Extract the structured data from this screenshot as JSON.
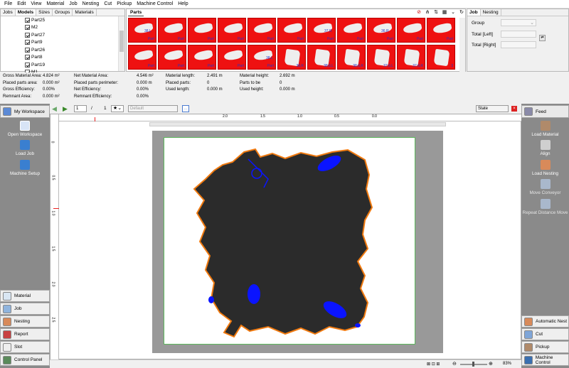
{
  "menu": [
    "File",
    "Edit",
    "View",
    "Material",
    "Job",
    "Nesting",
    "Cut",
    "Pickup",
    "Machine Control",
    "Help"
  ],
  "left_tabs": [
    "Jobs",
    "Models",
    "Sizes",
    "Groups",
    "Materials"
  ],
  "tree_items": [
    "Part25",
    "M2",
    "Part27",
    "Part9",
    "Part26",
    "Part8",
    "Part19",
    "M1"
  ],
  "parts_tab": "Parts",
  "parts_row1_labels": [
    "Part",
    "Part",
    "Part",
    "Part",
    "Part",
    "Part",
    "Part",
    "Part",
    "Part",
    "Part",
    "Part"
  ],
  "parts_row2_labels": [
    "Part",
    "Part",
    "Part",
    "Part",
    "Part",
    "38,R",
    "38,6,L",
    "38,6,R",
    "37,6,L",
    "37,6,R",
    "3"
  ],
  "tile_labels_overlay": {
    "r1c1": "38,L",
    "r1c7": "37,R",
    "r1c9": "36,R",
    "r2c5": "38,L"
  },
  "job_tabs": [
    "Job",
    "Nesting"
  ],
  "job_fields": {
    "group": "Group",
    "total_left": "Total [Left]",
    "total_right": "Total [Right]"
  },
  "stats": {
    "gross_area_label": "Gross Material Area:",
    "gross_area": "4.824 m²",
    "placed_area_label": "Placed parts area:",
    "placed_area": "0.000 m²",
    "gross_eff_label": "Gross Efficiency:",
    "gross_eff": "0.00%",
    "remnant_label": "Remnant Area:",
    "remnant": "0.000 m²",
    "net_area_label": "Net Material Area:",
    "net_area": "4.546 m²",
    "perimeter_label": "Placed parts perimeter:",
    "perimeter": "0.000 m",
    "net_eff_label": "Net Efficiency:",
    "net_eff": "0.00%",
    "remnant_eff_label": "Remnant Efficiency:",
    "remnant_eff": "0.00%",
    "mat_len_label": "Material length:",
    "mat_len": "2.491 m",
    "placed_parts_label": "Placed parts:",
    "placed_parts": "0",
    "used_len_label": "Used length:",
    "used_len": "0.000 m",
    "mat_h_label": "Material height:",
    "mat_h": "2.692 m",
    "tobe_label": "Parts to be",
    "tobe": "0",
    "used_h_label": "Used height:",
    "used_h": "0.000 m"
  },
  "toolbar": {
    "page": "1",
    "page_sep": "/",
    "page_total": "1",
    "preset": "Default",
    "state": "State"
  },
  "left_side": {
    "header": "My Workspace",
    "actions": [
      "Open Workspace",
      "Load Job",
      "Machine Setup"
    ],
    "bottom": [
      "Material",
      "Job",
      "Nesting",
      "Report",
      "Slot",
      "Control Panel"
    ]
  },
  "right_side": {
    "header": "Feed",
    "actions": [
      "Load Material",
      "Align",
      "Load Nesting",
      "Move Conveyor",
      "Repeat Distance Move"
    ],
    "bottom": [
      "Automatic Nest",
      "Cut",
      "Pickup",
      "Machine Control"
    ]
  },
  "ruler_top": [
    "2.0",
    "1.5",
    "1.0",
    "0.5",
    "0.0"
  ],
  "ruler_left": [
    "0",
    "0.5",
    "1.0",
    "1.5",
    "2.0",
    "2.5"
  ],
  "zoom": "83%",
  "colors": {
    "tile_red": "#e11111",
    "hide": "#2b2b2b",
    "hole": "#0a14ff",
    "outline": "#f07a10"
  }
}
